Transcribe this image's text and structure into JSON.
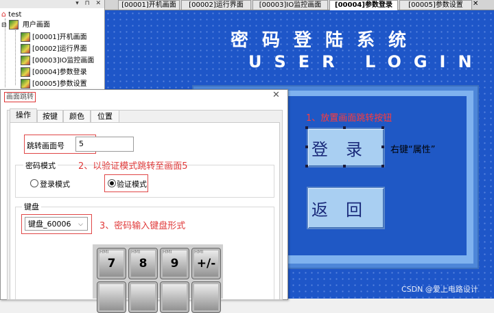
{
  "tree": {
    "root": "test",
    "group": "用户画面",
    "items": [
      "[00001]开机画面",
      "[00002]运行界面",
      "[00003]IO监控画面",
      "[00004]参数登录",
      "[00005]参数设置"
    ],
    "selected_index": 3
  },
  "tabs": [
    "[00001]开机画面",
    "[00002]运行界面",
    "[00003]IO监控画面",
    "[00004]参数登录",
    "[00005]参数设置"
  ],
  "active_tab": 3,
  "screen": {
    "title_cn": "密码登陆系统",
    "title_en": "USER LOGIN",
    "login_button": "登录",
    "back_button": "返回",
    "note1": "1、放置画面跳转按钮",
    "right_click_note": "右键“属性”",
    "watermark": "CSDN @爱上电路设计"
  },
  "dialog": {
    "title": "画面跳转",
    "tabs": [
      "操作",
      "按键",
      "颜色",
      "位置"
    ],
    "active_tab": 0,
    "jump_label": "跳转画面号",
    "jump_value": "5",
    "password_mode_group": "密码模式",
    "note2": "2、以验证模式跳转至画面5",
    "radio_login": "登录模式",
    "radio_verify": "验证模式",
    "verify_selected": true,
    "keyboard_group": "键盘",
    "keyboard_value": "键盘_60006",
    "note3": "3、密码输入键盘形式",
    "keys": [
      "7",
      "8",
      "9",
      "+/-"
    ],
    "key_tag": "HMI"
  }
}
